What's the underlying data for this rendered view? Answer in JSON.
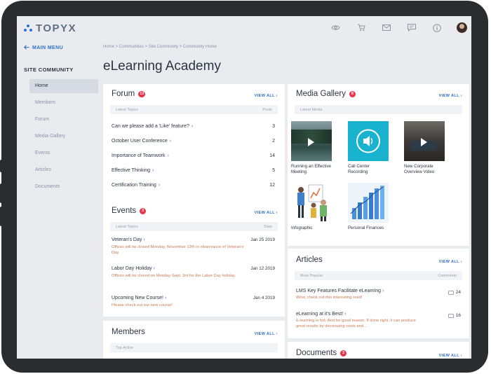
{
  "app": {
    "logo": "TOPYX"
  },
  "sidebar": {
    "main_menu": "MAIN MENU",
    "section": "SITE COMMUNITY",
    "items": [
      {
        "label": "Home",
        "active": true
      },
      {
        "label": "Members"
      },
      {
        "label": "Forum"
      },
      {
        "label": "Media Gallery"
      },
      {
        "label": "Events"
      },
      {
        "label": "Articles"
      },
      {
        "label": "Documents"
      }
    ]
  },
  "breadcrumb": "Home  >  Communities  >  Site Community  >  Community Home",
  "page_title": "eLearning Academy",
  "forum": {
    "title": "Forum",
    "badge": "13",
    "view_all": "VIEW ALL",
    "col_left": "Latest Topics",
    "col_right": "Posts",
    "rows": [
      {
        "topic": "Can we please add a 'Like' feature?",
        "posts": "3"
      },
      {
        "topic": "October User Conference",
        "posts": "2"
      },
      {
        "topic": "Importance of Teamwork",
        "posts": "14"
      },
      {
        "topic": "Effective Thinking",
        "posts": "5"
      },
      {
        "topic": "Certification Training",
        "posts": "12"
      }
    ]
  },
  "events": {
    "title": "Events",
    "badge": "3",
    "view_all": "VIEW ALL",
    "col_left": "Latest Topics",
    "col_right": "Date",
    "rows": [
      {
        "title": "Veteran's Day",
        "date": "Jan 25 2019",
        "desc": "Offices will be closed Monday, November 12th in observance of Veteran's Day."
      },
      {
        "title": "Labor Day Holiday",
        "date": "Jan 12 2019",
        "desc": "Offices will be closed on Monday Sept. 3rd for the Labor Day holiday."
      },
      {
        "title": "Upcoming New Course!",
        "date": "Jan 4 2019",
        "desc": "Please check out our new course!"
      }
    ]
  },
  "members": {
    "title": "Members",
    "view_all": "VIEW ALL",
    "col_left": "Top Active"
  },
  "media": {
    "title": "Media Gallery",
    "badge": "8",
    "view_all": "VIEW ALL",
    "col_left": "Latest Media",
    "items": [
      {
        "label": "Running an Effective Meeting"
      },
      {
        "label": "Call Center Recording"
      },
      {
        "label": "New Corporate Overview Video"
      },
      {
        "label": "Infographic"
      },
      {
        "label": "Personal Finances"
      }
    ]
  },
  "articles": {
    "title": "Articles",
    "view_all": "VIEW ALL",
    "col_left": "Most Popular",
    "col_right": "Comments",
    "rows": [
      {
        "title": "LMS Key Features Facilitate eLearning",
        "count": "24",
        "desc": "Wow, check out this interesting read!"
      },
      {
        "title": "eLearning at it's Best!",
        "count": "16",
        "desc": "E-learning is hot. And for good reason. If done right, it can produce great results by decreasing costs and..."
      }
    ]
  },
  "documents": {
    "title": "Documents",
    "badge": "2",
    "view_all": "VIEW ALL"
  },
  "colors": {
    "accent": "#2f6fcf",
    "badge": "#e8344b",
    "description": "#c97a52"
  }
}
